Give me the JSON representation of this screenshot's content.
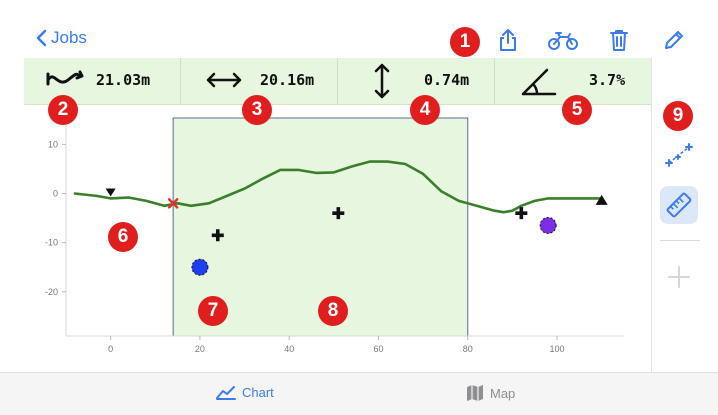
{
  "nav": {
    "back_label": "Jobs"
  },
  "toolbar": {
    "icons": [
      "share-icon",
      "bike-icon",
      "trash-icon",
      "pencil-icon"
    ]
  },
  "stats": [
    {
      "icon": "wave-distance-icon",
      "value": "21.03m"
    },
    {
      "icon": "horizontal-arrow-icon",
      "value": "20.16m"
    },
    {
      "icon": "vertical-arrow-icon",
      "value": "0.74m"
    },
    {
      "icon": "angle-icon",
      "value": "3.7%"
    }
  ],
  "sidebar": {
    "buttons": [
      "measure-points-icon",
      "ruler-icon",
      "add-icon"
    ]
  },
  "chart_data": {
    "type": "line",
    "x_ticks": [
      "0",
      "20",
      "40",
      "60",
      "80",
      "100"
    ],
    "y_ticks": [
      "10",
      "0",
      "-10",
      "-20"
    ],
    "xlim": [
      -10,
      115
    ],
    "ylim": [
      -29,
      17
    ],
    "series": [
      {
        "x": [
          -8,
          -3,
          0,
          4,
          8,
          12,
          15,
          18,
          22,
          26,
          30,
          34,
          38,
          42,
          46,
          50,
          54,
          58,
          62,
          66,
          70,
          74,
          78,
          82,
          86,
          88,
          90,
          92,
          95,
          98,
          101,
          104,
          107,
          110
        ],
        "y": [
          0,
          -0.5,
          -1,
          -0.8,
          -1.5,
          -2.5,
          -2,
          -2.5,
          -2,
          -0.5,
          1,
          3,
          4.8,
          4.8,
          4.2,
          4.3,
          5.5,
          6.5,
          6.5,
          6,
          4,
          0.5,
          -1.5,
          -2.5,
          -3.5,
          -3.8,
          -3.5,
          -2.5,
          -1.5,
          -1,
          -1,
          -1,
          -1,
          -1
        ],
        "color": "#3a7f2a"
      }
    ],
    "highlight_x": [
      14,
      80
    ],
    "markers": [
      {
        "kind": "triangle-down",
        "x": 0,
        "y": 0
      },
      {
        "kind": "cross-x",
        "x": 14,
        "y": -2
      },
      {
        "kind": "plus",
        "x": 24,
        "y": -8.5
      },
      {
        "kind": "plus",
        "x": 51,
        "y": -4
      },
      {
        "kind": "plus",
        "x": 92,
        "y": -4
      },
      {
        "kind": "dot",
        "x": 20,
        "y": -15,
        "color": "#1f3ef0"
      },
      {
        "kind": "dot",
        "x": 98,
        "y": -6.5,
        "color": "#7c2ee6"
      },
      {
        "kind": "triangle-up",
        "x": 110,
        "y": -1.5
      }
    ]
  },
  "badges": [
    "1",
    "2",
    "3",
    "4",
    "5",
    "6",
    "7",
    "8",
    "9"
  ],
  "tabs": [
    {
      "label": "Chart",
      "icon": "chart-icon",
      "active": true
    },
    {
      "label": "Map",
      "icon": "map-icon",
      "active": false
    }
  ],
  "colors": {
    "accent": "#3a7cf0",
    "badge": "#e01e1e",
    "highlight": "#e6f6df",
    "line": "#3a7f2a"
  }
}
